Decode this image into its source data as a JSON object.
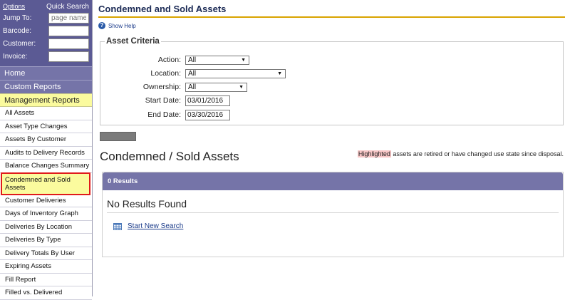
{
  "quick_search": {
    "options_label": "Options",
    "title": "Quick Search",
    "jump_to_label": "Jump To:",
    "jump_to_placeholder": "page name",
    "barcode_label": "Barcode:",
    "customer_label": "Customer:",
    "invoice_label": "Invoice:"
  },
  "nav": {
    "home": "Home",
    "custom_reports": "Custom Reports",
    "management_reports": "Management Reports",
    "items": [
      "All Assets",
      "Asset Type Changes",
      "Assets By Customer",
      "Audits to Delivery Records",
      "Balance Changes Summary",
      "Condemned and Sold Assets",
      "Customer Deliveries",
      "Days of Inventory Graph",
      "Deliveries By Location",
      "Deliveries By Type",
      "Delivery Totals By User",
      "Expiring Assets",
      "Fill Report",
      "Filled vs. Delivered"
    ]
  },
  "page": {
    "title": "Condemned and Sold Assets",
    "help_label": "Show Help"
  },
  "criteria": {
    "legend": "Asset Criteria",
    "action_label": "Action:",
    "action_value": "All",
    "location_label": "Location:",
    "location_value": "All",
    "ownership_label": "Ownership:",
    "ownership_value": "All",
    "start_date_label": "Start Date:",
    "start_date_value": "03/01/2016",
    "end_date_label": "End Date:",
    "end_date_value": "03/30/2016"
  },
  "results": {
    "heading": "Condemned / Sold Assets",
    "note_highlight": "Highlighted",
    "note_rest": " assets are retired or have changed use state since disposal.",
    "count_label": "0 Results",
    "no_results": "No Results Found",
    "new_search": "Start New Search"
  },
  "colors": {
    "sidebar_dark": "#5b5a94",
    "nav_purple": "#7574a8",
    "yellow_highlight": "#fbfb9e",
    "active_outline": "#e01b1b",
    "title_rule": "#d9a400"
  }
}
